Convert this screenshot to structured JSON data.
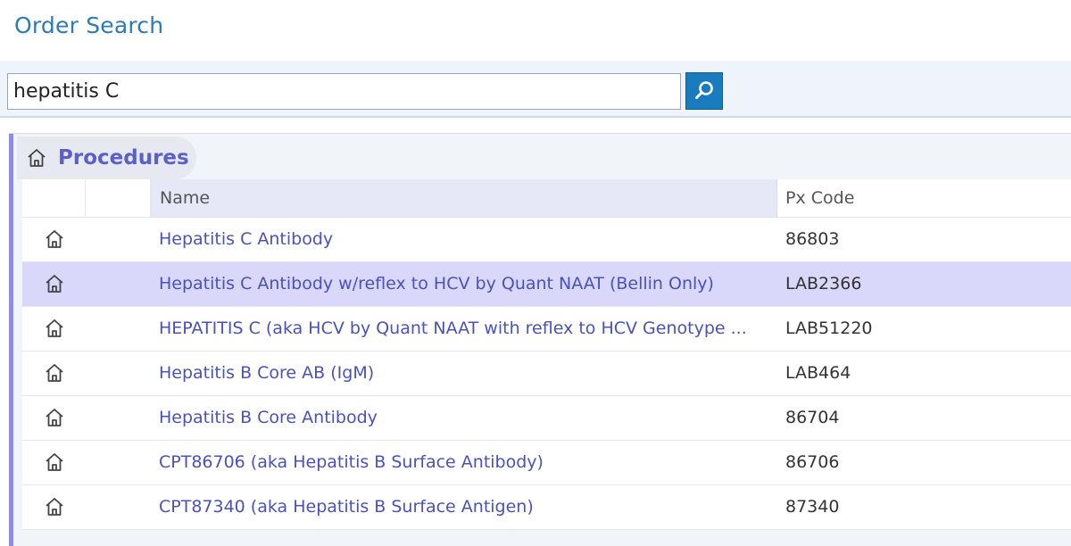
{
  "page": {
    "title": "Order Search"
  },
  "search": {
    "value": "hepatitis C",
    "button_icon": "search-icon"
  },
  "section": {
    "label": "Procedures",
    "icon": "home-icon"
  },
  "table": {
    "columns": [
      "Name",
      "Px Code"
    ],
    "rows": [
      {
        "name": "Hepatitis C Antibody",
        "code": "86803",
        "selected": false
      },
      {
        "name": "Hepatitis C Antibody w/reflex to HCV by Quant NAAT (Bellin Only)",
        "code": "LAB2366",
        "selected": true
      },
      {
        "name": "HEPATITIS C (aka HCV by Quant NAAT with reflex to HCV Genotype ...",
        "code": "LAB51220",
        "selected": false
      },
      {
        "name": "Hepatitis B Core AB (IgM)",
        "code": "LAB464",
        "selected": false
      },
      {
        "name": "Hepatitis B Core Antibody",
        "code": "86704",
        "selected": false
      },
      {
        "name": "CPT86706 (aka Hepatitis B Surface Antibody)",
        "code": "86706",
        "selected": false
      },
      {
        "name": "CPT87340 (aka Hepatitis B Surface Antigen)",
        "code": "87340",
        "selected": false
      }
    ]
  },
  "colors": {
    "accent": "#1a7bbd",
    "title": "#2b7bb5",
    "link": "#4a52b8",
    "selected_row": "#d9d8fb",
    "panel_bar": "#8e8ce8"
  }
}
